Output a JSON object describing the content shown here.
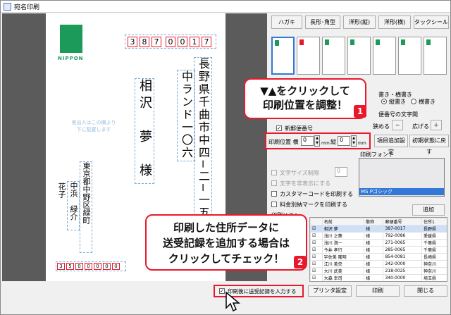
{
  "window": {
    "title": "宛名印刷"
  },
  "card": {
    "postal_digits": [
      "3",
      "8",
      "7",
      "0",
      "0",
      "1",
      "7"
    ],
    "logo_text": "NIPPON",
    "address_line1": "長野県千曲市中四−二−一五",
    "address_line2": "中ランド一〇六",
    "recipient_name": "相沢　夢　様",
    "placeholder_line1": "差出人はこの欄より",
    "placeholder_line2": "下に配置します",
    "sender_address": "東京都中野区緑町",
    "sender_name": "中浜　緑介",
    "sender_name2": "花子",
    "sender_postal_digits": [
      "3",
      "5",
      "0",
      "0",
      "0",
      "0",
      "0"
    ]
  },
  "toolbar": {
    "buttons": [
      "ハガキ",
      "長形･角型",
      "洋形(縦)",
      "洋形(横)",
      "タックシール"
    ]
  },
  "options": {
    "orientation_title": "書き・横書き",
    "vertical_label": "縦書き",
    "horizontal_label": "横書き",
    "postal_digit_title": "便番号の文字間",
    "narrow_label": "狭める",
    "widen_label": "広げる",
    "new_postal_label": "新郵便番号",
    "print_pos_label": "印刷位置 横",
    "pos_x": "0",
    "pos_y": "0",
    "mm1": "mm",
    "vert_label": "縦",
    "mm2": "mm",
    "setting_btn": "項目追加設定",
    "reset_btn": "初期状態に戻す",
    "font_title": "印刷フォント",
    "font_items": [
      "",
      "",
      "",
      "",
      "",
      "",
      "MS Pゴシック"
    ],
    "fit_text_label": "文字サイズ制限",
    "outline_text_label": "文字を非表示にする",
    "customer_code_label": "カスタマーコードを印刷する",
    "postage_label": "料金別納マークを印刷する"
  },
  "list": {
    "title": "印刷リスト",
    "add_button": "追加",
    "headers": [
      "名前",
      "敬称",
      "郵便番号",
      "住所1"
    ],
    "rows": [
      [
        "相沢 夢",
        "様",
        "387-0017",
        "長野県"
      ],
      [
        "浅川 之葉",
        "様",
        "792-0086",
        "愛媛県"
      ],
      [
        "浅川 満一",
        "様",
        "271-0065",
        "千葉県"
      ],
      [
        "今井 孝行",
        "様",
        "285-0065",
        "千葉県"
      ],
      [
        "宇佐美 隆明",
        "様",
        "854-0081",
        "長崎県"
      ],
      [
        "江川 美央",
        "様",
        "242-0000",
        "神奈川"
      ],
      [
        "大川 武美",
        "様",
        "218-0025",
        "神奈川"
      ],
      [
        "大森 幸司",
        "様",
        "340-0000",
        "埼玉県"
      ]
    ]
  },
  "footer": {
    "record_checkbox": "印刷後に送受記録を入力する",
    "printer_btn": "プリンタ設定",
    "print_btn": "印刷",
    "close_btn": "閉じる"
  },
  "callouts": {
    "one_text_line1": "▼▲をクリックして",
    "one_text_line2": "印刷位置を調整！",
    "one_num": "1",
    "two_text_line1": "印刷した住所データに",
    "two_text_line2": "送受記録を追加する場合は",
    "two_text_line3": "クリックしてチェック！",
    "two_num": "2"
  },
  "colors": {
    "accent_red": "#e8192c",
    "logo_green": "#1b9a5a",
    "selection_blue": "#3378d6"
  }
}
